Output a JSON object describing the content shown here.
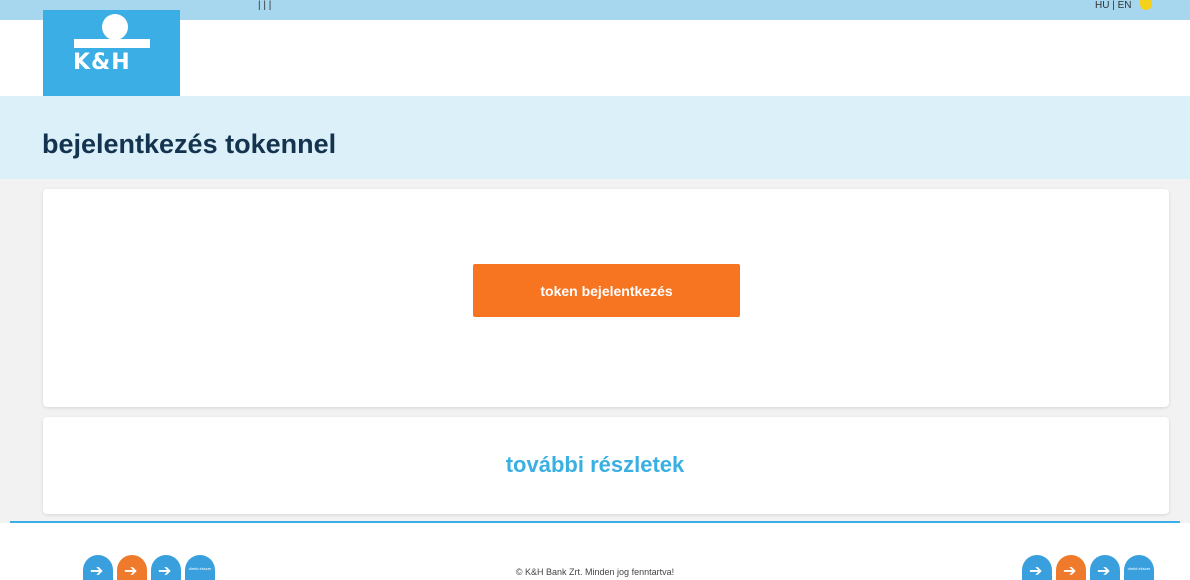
{
  "topbar": {
    "fragment_left": "| | |",
    "fragment_right": "HU | EN"
  },
  "logo": {
    "text": "K&H"
  },
  "page": {
    "title": "bejelentkezés tokennel"
  },
  "login": {
    "button_label": "token bejelentkezés"
  },
  "details": {
    "link_label": "további részletek"
  },
  "footer": {
    "copyright": "© K&H Bank Zrt. Minden jog fenntartva!",
    "badge_small_text": "direkt ékszer"
  },
  "colors": {
    "brand_blue": "#3aaee5",
    "accent_orange": "#f77421",
    "title_navy": "#13334f",
    "link_blue": "#3ab0e2",
    "band": "#dcf0f9"
  },
  "icons": [
    "arrow-right-icon",
    "arrow-right-icon",
    "arrow-right-icon",
    "badge-icon"
  ]
}
